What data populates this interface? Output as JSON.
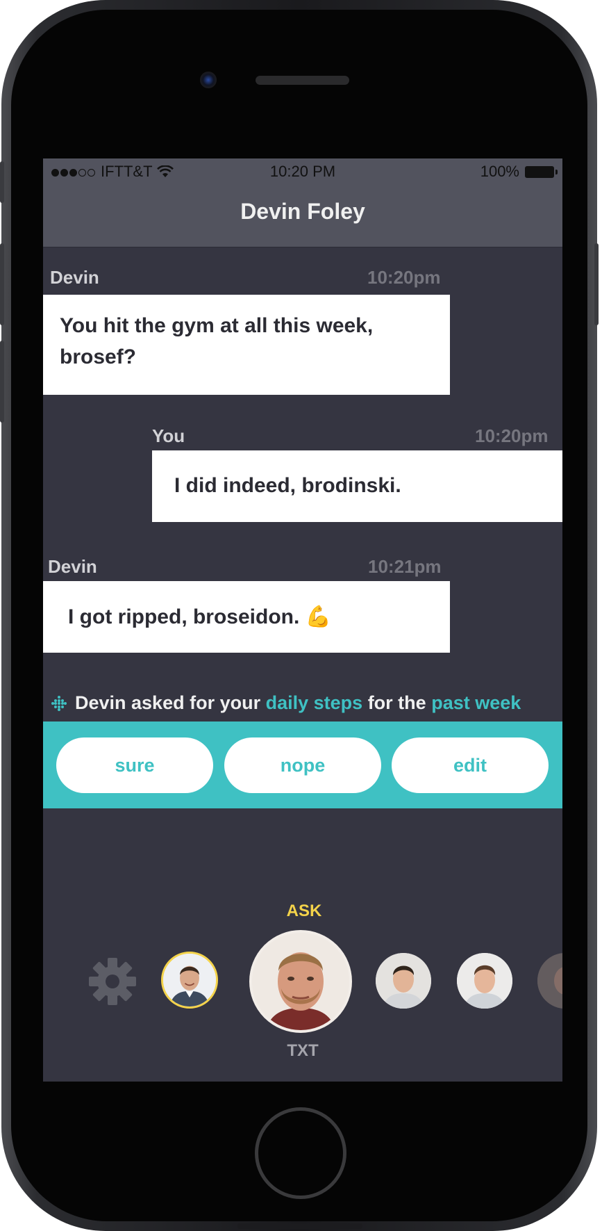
{
  "status_bar": {
    "carrier": "IFTT&T",
    "time": "10:20 PM",
    "battery": "100%"
  },
  "header": {
    "title": "Devin Foley"
  },
  "messages": [
    {
      "sender": "Devin",
      "time": "10:20pm",
      "text": "You hit the gym at all this week, brosef?"
    },
    {
      "sender": "You",
      "time": "10:20pm",
      "text": "I did indeed, brodinski."
    },
    {
      "sender": "Devin",
      "time": "10:21pm",
      "text": "I got ripped, broseidon.",
      "emoji": "💪"
    }
  ],
  "request": {
    "prefix": "Devin asked for your",
    "metric": "daily steps",
    "middle": "for the",
    "period": "past week"
  },
  "actions": {
    "sure": "sure",
    "nope": "nope",
    "edit": "edit"
  },
  "contacts": {
    "ask_label": "ASK",
    "txt_label": "TXT"
  },
  "icons": {
    "status": [
      "signal-dots-icon",
      "wifi-icon",
      "battery-icon"
    ],
    "request": "fitbit-icon",
    "settings": "gear-icon"
  },
  "colors": {
    "accent": "#3fc1c3",
    "ask": "#f4d34a",
    "background": "#353541",
    "header": "#52535e"
  }
}
